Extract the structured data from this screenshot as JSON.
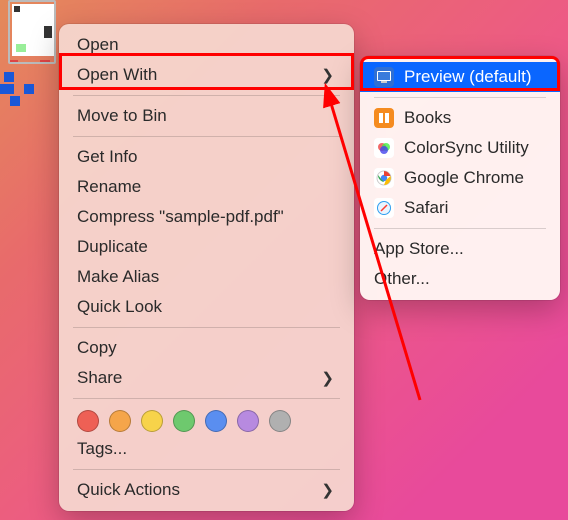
{
  "contextMenu": {
    "open": "Open",
    "openWith": "Open With",
    "moveToBin": "Move to Bin",
    "getInfo": "Get Info",
    "rename": "Rename",
    "compress": "Compress \"sample-pdf.pdf\"",
    "duplicate": "Duplicate",
    "makeAlias": "Make Alias",
    "quickLook": "Quick Look",
    "copy": "Copy",
    "share": "Share",
    "tags": "Tags...",
    "quickActions": "Quick Actions"
  },
  "submenu": {
    "preview": "Preview (default)",
    "books": "Books",
    "colorsync": "ColorSync Utility",
    "chrome": "Google Chrome",
    "safari": "Safari",
    "appStore": "App Store...",
    "other": "Other..."
  },
  "colors": {
    "red": "#ee6055",
    "orange": "#f5a54a",
    "yellow": "#f7d34a",
    "green": "#6ec96e",
    "blue": "#5a8ef0",
    "purple": "#b78ae0",
    "gray": "#b0b0b0"
  },
  "iconColors": {
    "preview": "#2f6fd4",
    "books": "#f58b1f",
    "colorsync": "#d94b8a",
    "chrome": "#ffffff",
    "safari": "#2f9ff0"
  }
}
